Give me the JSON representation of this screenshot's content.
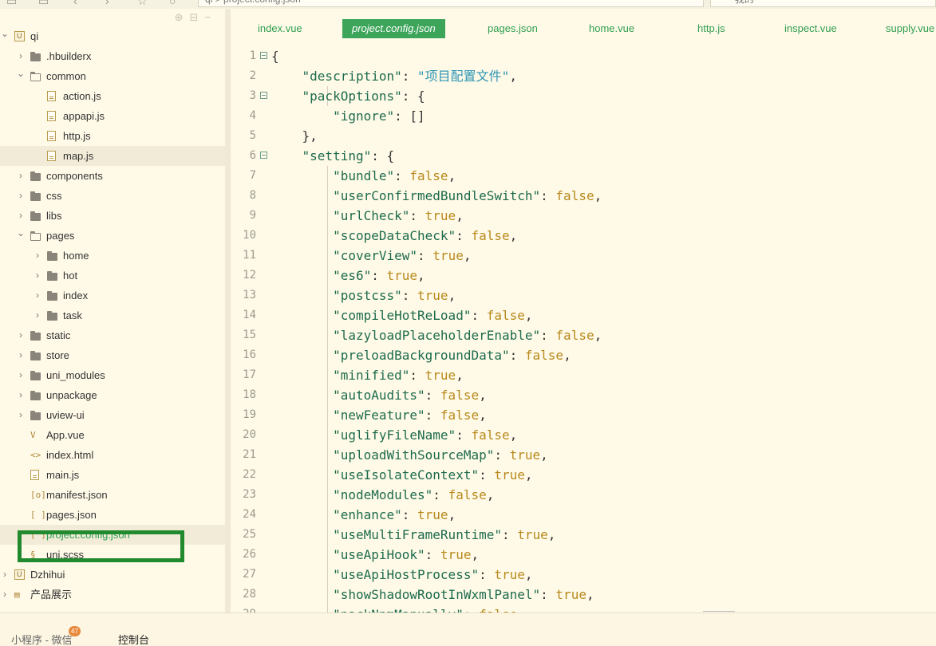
{
  "toolbar": {
    "address_text": "qi  >  project.config.json",
    "search_text": "我的",
    "icons": [
      "file-icon",
      "save-icon",
      "back-icon",
      "forward-icon",
      "star-icon",
      "run-icon"
    ]
  },
  "sidebar": {
    "tool_icons": [
      "target-icon",
      "collapse-icon",
      "minimize-icon"
    ],
    "tree": [
      {
        "label": "qi",
        "type": "project",
        "level": 0,
        "expanded": true
      },
      {
        "label": ".hbuilderx",
        "type": "folder",
        "level": 1,
        "expanded": false
      },
      {
        "label": "common",
        "type": "folder",
        "level": 1,
        "expanded": true
      },
      {
        "label": "action.js",
        "type": "file",
        "level": 2
      },
      {
        "label": "appapi.js",
        "type": "file",
        "level": 2
      },
      {
        "label": "http.js",
        "type": "file",
        "level": 2
      },
      {
        "label": "map.js",
        "type": "file",
        "level": 2,
        "selected": true
      },
      {
        "label": "components",
        "type": "folder",
        "level": 1,
        "expanded": false
      },
      {
        "label": "css",
        "type": "folder",
        "level": 1,
        "expanded": false
      },
      {
        "label": "libs",
        "type": "folder",
        "level": 1,
        "expanded": false
      },
      {
        "label": "pages",
        "type": "folder",
        "level": 1,
        "expanded": true
      },
      {
        "label": "home",
        "type": "folder",
        "level": 2,
        "expanded": false
      },
      {
        "label": "hot",
        "type": "folder",
        "level": 2,
        "expanded": false
      },
      {
        "label": "index",
        "type": "folder",
        "level": 2,
        "expanded": false
      },
      {
        "label": "task",
        "type": "folder",
        "level": 2,
        "expanded": false
      },
      {
        "label": "static",
        "type": "folder",
        "level": 1,
        "expanded": false
      },
      {
        "label": "store",
        "type": "folder",
        "level": 1,
        "expanded": false
      },
      {
        "label": "uni_modules",
        "type": "folder",
        "level": 1,
        "expanded": false
      },
      {
        "label": "unpackage",
        "type": "folder",
        "level": 1,
        "expanded": false
      },
      {
        "label": "uview-ui",
        "type": "folder",
        "level": 1,
        "expanded": false
      },
      {
        "label": "App.vue",
        "type": "vue",
        "level": 1,
        "glyph": "V"
      },
      {
        "label": "index.html",
        "type": "html",
        "level": 1,
        "glyph": "<>"
      },
      {
        "label": "main.js",
        "type": "file",
        "level": 1
      },
      {
        "label": "manifest.json",
        "type": "manifest",
        "level": 1,
        "glyph": "[o]"
      },
      {
        "label": "pages.json",
        "type": "json",
        "level": 1,
        "glyph": "[ ]"
      },
      {
        "label": "project.config.json",
        "type": "json",
        "level": 1,
        "glyph": "[ ]",
        "active": true,
        "selected": true
      },
      {
        "label": "uni.scss",
        "type": "scss",
        "level": 1,
        "glyph": "§"
      },
      {
        "label": "Dzhihui",
        "type": "project",
        "level": 0,
        "expanded": false
      },
      {
        "label": "产品展示",
        "type": "doc",
        "level": 0,
        "expanded": false,
        "glyph": "▤"
      }
    ]
  },
  "editor": {
    "tabs": [
      "index.vue",
      "project.config.json",
      "pages.json",
      "home.vue",
      "http.js",
      "inspect.vue",
      "supply.vue"
    ],
    "active_tab": "project.config.json",
    "lines": [
      {
        "n": "1",
        "fold": true,
        "html": "{"
      },
      {
        "n": "2",
        "html": "    <span class=\"k\">\"description\"</span>: <span class=\"s\">\"项目配置文件\"</span>,"
      },
      {
        "n": "3",
        "fold": true,
        "html": "    <span class=\"k\">\"packOptions\"</span>: {"
      },
      {
        "n": "4",
        "html": "        <span class=\"k\">\"ignore\"</span>: []"
      },
      {
        "n": "5",
        "html": "    },"
      },
      {
        "n": "6",
        "fold": true,
        "html": "    <span class=\"k\">\"setting\"</span>: {"
      },
      {
        "n": "7",
        "html": "        <span class=\"k\">\"bundle\"</span>: <span class=\"b\">false</span>,"
      },
      {
        "n": "8",
        "html": "        <span class=\"k\">\"userConfirmedBundleSwitch\"</span>: <span class=\"b\">false</span>,"
      },
      {
        "n": "9",
        "html": "        <span class=\"k\">\"urlCheck\"</span>: <span class=\"b\">true</span>,"
      },
      {
        "n": "10",
        "html": "        <span class=\"k\">\"scopeDataCheck\"</span>: <span class=\"b\">false</span>,"
      },
      {
        "n": "11",
        "html": "        <span class=\"k\">\"coverView\"</span>: <span class=\"b\">true</span>,"
      },
      {
        "n": "12",
        "html": "        <span class=\"k\">\"es6\"</span>: <span class=\"b\">true</span>,"
      },
      {
        "n": "13",
        "html": "        <span class=\"k\">\"postcss\"</span>: <span class=\"b\">true</span>,"
      },
      {
        "n": "14",
        "html": "        <span class=\"k\">\"compileHotReLoad\"</span>: <span class=\"b\">false</span>,"
      },
      {
        "n": "15",
        "html": "        <span class=\"k\">\"lazyloadPlaceholderEnable\"</span>: <span class=\"b\">false</span>,"
      },
      {
        "n": "16",
        "html": "        <span class=\"k\">\"preloadBackgroundData\"</span>: <span class=\"b\">false</span>,"
      },
      {
        "n": "17",
        "html": "        <span class=\"k\">\"minified\"</span>: <span class=\"b\">true</span>,"
      },
      {
        "n": "18",
        "html": "        <span class=\"k\">\"autoAudits\"</span>: <span class=\"b\">false</span>,"
      },
      {
        "n": "19",
        "html": "        <span class=\"k\">\"newFeature\"</span>: <span class=\"b\">false</span>,"
      },
      {
        "n": "20",
        "html": "        <span class=\"k\">\"uglifyFileName\"</span>: <span class=\"b\">false</span>,"
      },
      {
        "n": "21",
        "html": "        <span class=\"k\">\"uploadWithSourceMap\"</span>: <span class=\"b\">true</span>,"
      },
      {
        "n": "22",
        "html": "        <span class=\"k\">\"useIsolateContext\"</span>: <span class=\"b\">true</span>,"
      },
      {
        "n": "23",
        "html": "        <span class=\"k\">\"nodeModules\"</span>: <span class=\"b\">false</span>,"
      },
      {
        "n": "24",
        "html": "        <span class=\"k\">\"enhance\"</span>: <span class=\"b\">true</span>,"
      },
      {
        "n": "25",
        "html": "        <span class=\"k\">\"useMultiFrameRuntime\"</span>: <span class=\"b\">true</span>,"
      },
      {
        "n": "26",
        "html": "        <span class=\"k\">\"useApiHook\"</span>: <span class=\"b\">true</span>,"
      },
      {
        "n": "27",
        "html": "        <span class=\"k\">\"useApiHostProcess\"</span>: <span class=\"b\">true</span>,"
      },
      {
        "n": "28",
        "html": "        <span class=\"k\">\"showShadowRootInWxmlPanel\"</span>: <span class=\"b\">true</span>,"
      },
      {
        "n": "29",
        "html": "        <span class=\"k\">\"packNpmManually\"</span>: <span class=\"b\">false</span>,"
      }
    ]
  },
  "bottom": {
    "tabs": [
      "小程序 - 微信",
      "控制台"
    ],
    "active_tab": "控制台",
    "badge": "47"
  }
}
